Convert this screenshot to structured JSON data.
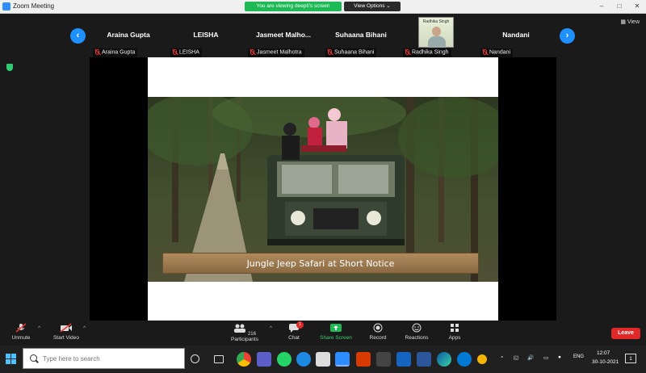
{
  "window": {
    "title": "Zoom Meeting",
    "share_banner": "You are viewing deepti's screen",
    "view_options": "View Options ⌄",
    "controls": [
      "–",
      "□",
      "✕"
    ]
  },
  "gallery": {
    "view_label": "View",
    "prev_arrow": "‹",
    "next_arrow": "›",
    "tiles": [
      {
        "big": "Araina Gupta",
        "small": "Araina Gupta"
      },
      {
        "big": "LEISHA",
        "small": "LEISHA"
      },
      {
        "big": "Jasmeet    Malho...",
        "small": "Jasmeet    Malhotra"
      },
      {
        "big": "Suhaana    Bihani",
        "small": "Suhaana Bihani"
      },
      {
        "big": "",
        "small": "Radhika Singh",
        "photo_caption": "Radhika Singh"
      },
      {
        "big": "Nandani",
        "small": "Nandani"
      }
    ]
  },
  "slide": {
    "banner_text": "Jungle Jeep Safari at Short Notice"
  },
  "toolbar": {
    "unmute": "Unmute",
    "start_video": "Start Video",
    "participants": "Participants",
    "participant_count": "216",
    "chat": "Chat",
    "chat_badge": "1",
    "share_screen": "Share Screen",
    "record": "Record",
    "reactions": "Reactions",
    "apps": "Apps",
    "leave": "Leave"
  },
  "taskbar": {
    "search_placeholder": "Type here to search",
    "language": "ENG",
    "time": "12:07",
    "date": "30-10-2021",
    "notification_count": "1"
  },
  "colors": {
    "accent_blue": "#1e90ff",
    "share_green": "#1db954",
    "leave_red": "#e02828"
  }
}
